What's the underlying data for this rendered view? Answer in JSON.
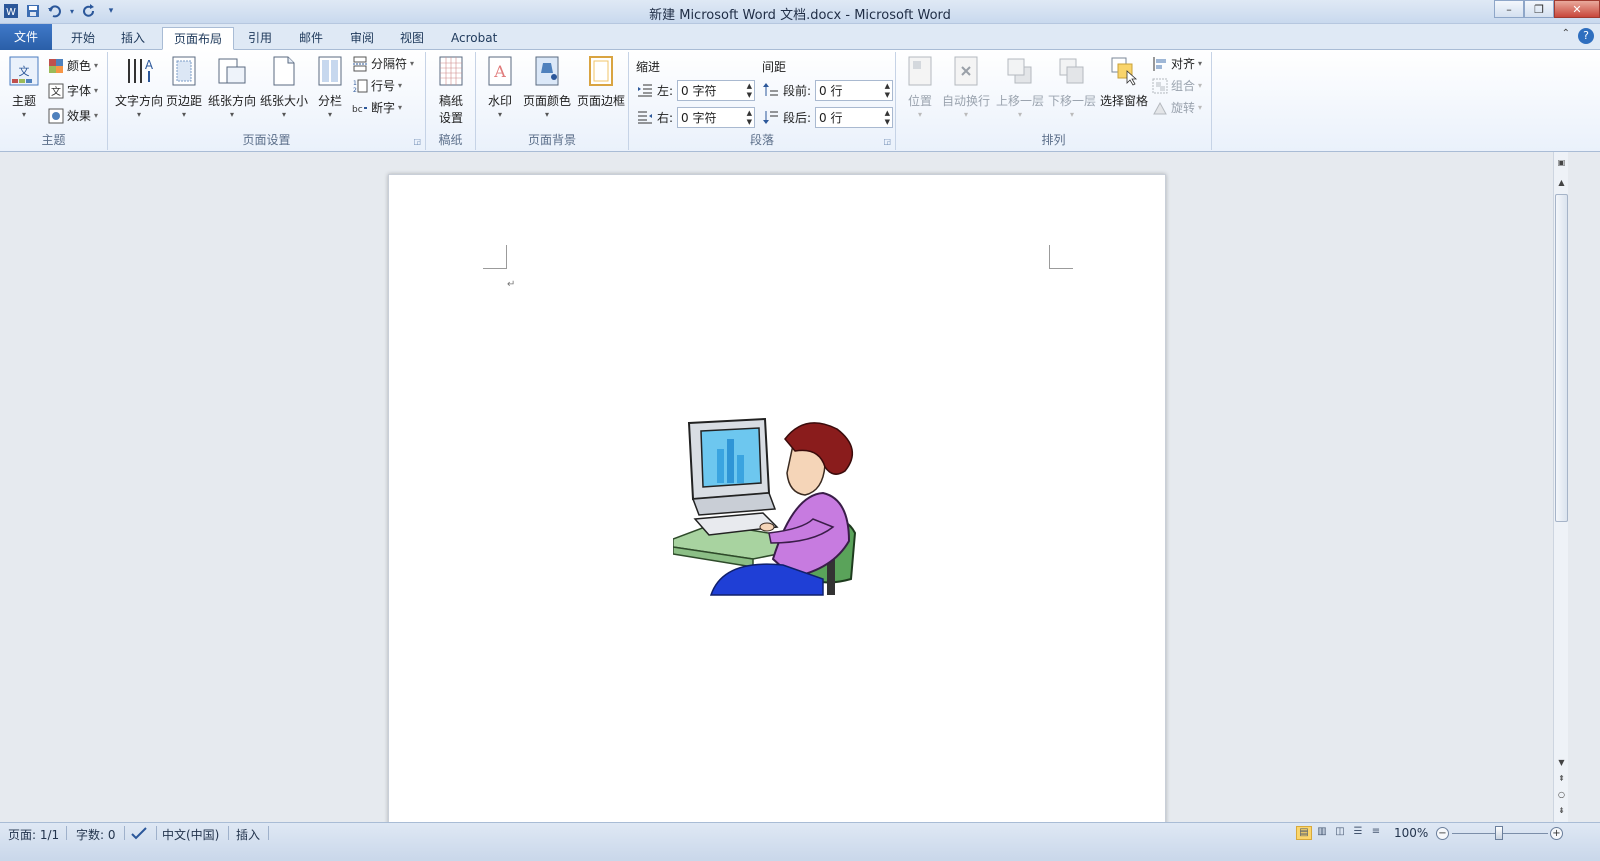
{
  "window": {
    "title": "新建 Microsoft Word 文档.docx - Microsoft Word"
  },
  "qat": {
    "icons": [
      "word-logo-icon",
      "save-icon",
      "undo-icon",
      "redo-icon",
      "customize-qat-icon"
    ]
  },
  "tabs": [
    {
      "label": "文件"
    },
    {
      "label": "开始"
    },
    {
      "label": "插入"
    },
    {
      "label": "页面布局"
    },
    {
      "label": "引用"
    },
    {
      "label": "邮件"
    },
    {
      "label": "审阅"
    },
    {
      "label": "视图"
    },
    {
      "label": "Acrobat"
    }
  ],
  "ribbon": {
    "theme": {
      "label": "主题",
      "big": "主题",
      "colors": "颜色",
      "fonts": "字体",
      "effects": "效果"
    },
    "page_setup": {
      "label": "页面设置",
      "text_direction": "文字方向",
      "margins": "页边距",
      "orientation": "纸张方向",
      "size": "纸张大小",
      "columns": "分栏",
      "breaks": "分隔符",
      "line_numbers": "行号",
      "hyphenation": "断字"
    },
    "draft": {
      "label": "稿纸",
      "settings_line1": "稿纸",
      "settings_line2": "设置"
    },
    "background": {
      "label": "页面背景",
      "watermark": "水印",
      "page_color": "页面颜色",
      "page_borders": "页面边框"
    },
    "paragraph": {
      "label": "段落",
      "indent": "缩进",
      "spacing": "间距",
      "left_label": "左:",
      "left_value": "0 字符",
      "right_label": "右:",
      "right_value": "0 字符",
      "before_label": "段前:",
      "before_value": "0 行",
      "after_label": "段后:",
      "after_value": "0 行"
    },
    "arrange": {
      "label": "排列",
      "position": "位置",
      "wrap": "自动换行",
      "bring_forward": "上移一层",
      "send_backward": "下移一层",
      "selection_pane": "选择窗格",
      "align": "对齐",
      "group": "组合",
      "rotate": "旋转"
    }
  },
  "status": {
    "page": "页面: 1/1",
    "words": "字数: 0",
    "language": "中文(中国)",
    "mode": "插入",
    "zoom": "100%"
  }
}
